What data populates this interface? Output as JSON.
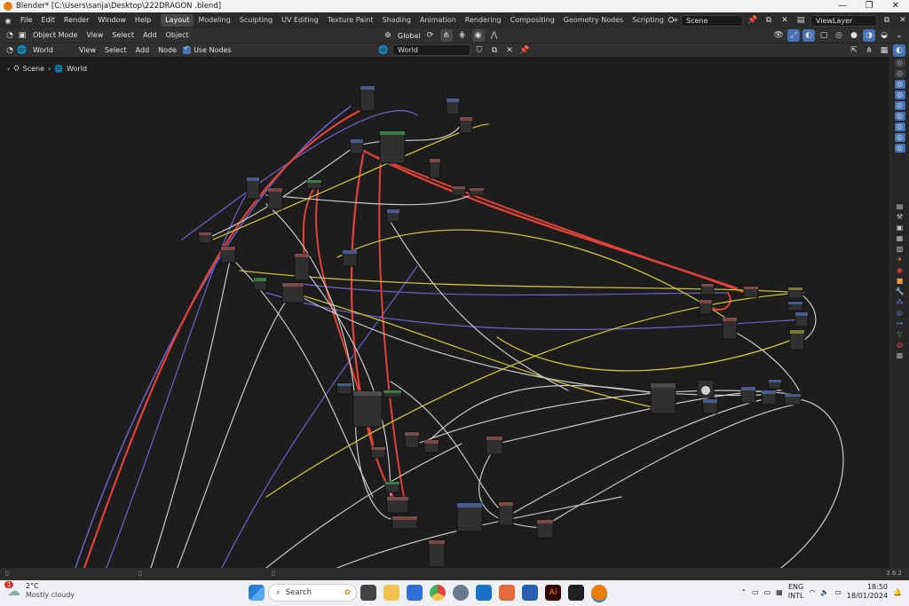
{
  "window": {
    "title": "Blender* [C:\\Users\\sanja\\Desktop\\222DRAGON .blend]",
    "minimize": "—",
    "maximize": "❐",
    "close": "✕"
  },
  "menu": [
    "File",
    "Edit",
    "Render",
    "Window",
    "Help"
  ],
  "workspaces": {
    "tabs": [
      "Layout",
      "Modeling",
      "Sculpting",
      "UV Editing",
      "Texture Paint",
      "Shading",
      "Animation",
      "Rendering",
      "Compositing",
      "Geometry Nodes",
      "Scripting"
    ],
    "add": "+",
    "active_index": 0
  },
  "scene": {
    "name": "Scene",
    "view_layer": "ViewLayer"
  },
  "header2": {
    "mode": "Object Mode",
    "items": [
      "View",
      "Select",
      "Add",
      "Object"
    ],
    "transform": "Global"
  },
  "header3": {
    "type": "World",
    "items": [
      "View",
      "Select",
      "Add",
      "Node"
    ],
    "use_nodes_label": "Use Nodes",
    "world_name": "World"
  },
  "breadcrumb": {
    "scene": "Scene",
    "world": "World"
  },
  "status": {
    "version": "3.6.2"
  },
  "taskbar": {
    "weather_temp": "2°C",
    "weather_desc": "Mostly cloudy",
    "weather_badge": "1",
    "search": "Search",
    "lang": "ENG",
    "layout": "INTL",
    "time": "18:50",
    "date": "18/01/2024"
  },
  "colors": {
    "link_red": "#e0413a",
    "link_white": "#c8c8c8",
    "link_yellow": "#c7c23a",
    "link_blue": "#6b63c7",
    "node_body": "#303030",
    "accent": "#4772b3"
  }
}
